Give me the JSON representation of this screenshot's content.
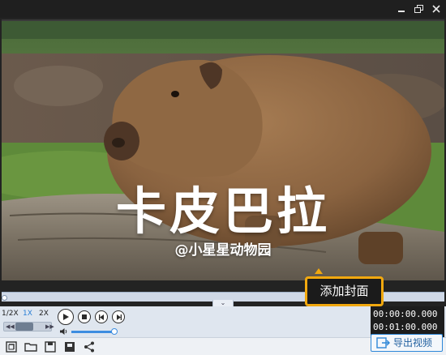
{
  "video": {
    "title_text": "卡皮巴拉",
    "subtitle_text": "@小星星动物园"
  },
  "tooltip": {
    "label": "添加封面"
  },
  "timeline": {
    "progress": 0.0
  },
  "speed": {
    "options": [
      "1/2X",
      "1X",
      "2X"
    ],
    "selected": "1X"
  },
  "volume": {
    "level": 0.95
  },
  "time": {
    "current": "00:00:00.000",
    "total": "00:01:00.000"
  },
  "toolbar": {
    "export_label": "导出视频",
    "icons": [
      "crop-icon",
      "folder-icon",
      "save-icon",
      "save-as-icon",
      "share-icon"
    ]
  },
  "colors": {
    "accent": "#2a7fd6",
    "tooltip_border": "#f1a80f",
    "time_bg": "#1d1d1d"
  }
}
